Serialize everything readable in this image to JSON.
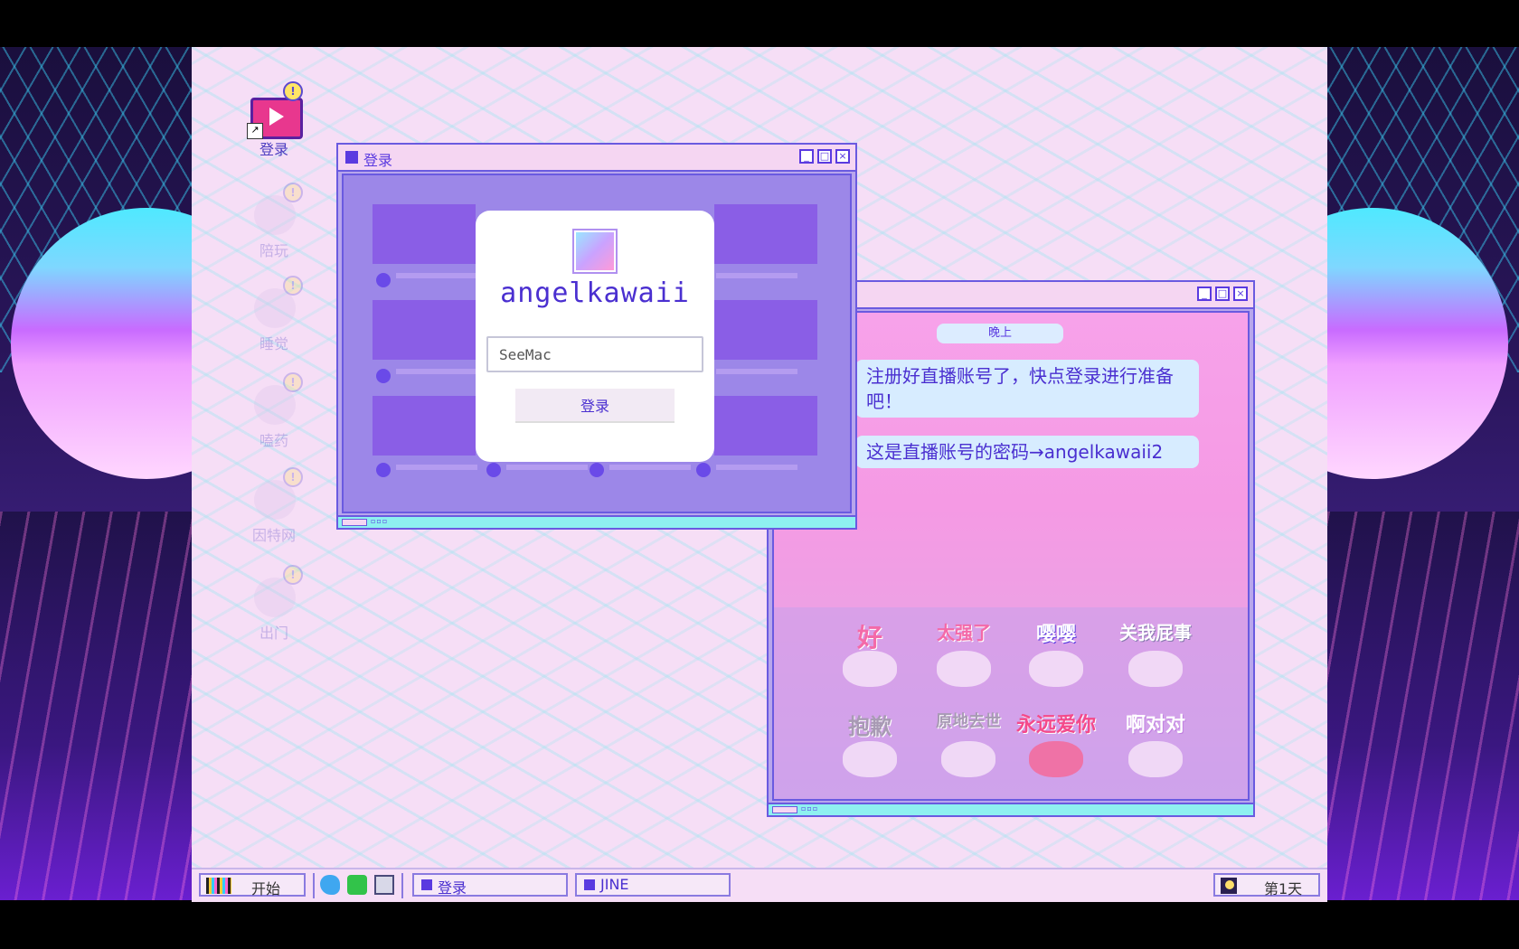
{
  "desktop": {
    "icons": [
      {
        "label": "登录",
        "badge": "!"
      },
      {
        "label": "陪玩",
        "badge": "!"
      },
      {
        "label": "睡觉",
        "badge": "!"
      },
      {
        "label": "嗑药",
        "badge": "!"
      },
      {
        "label": "因特网",
        "badge": "!"
      },
      {
        "label": "出门",
        "badge": "!"
      }
    ]
  },
  "login_window": {
    "title": "登录",
    "modal": {
      "username": "angelkawaii",
      "password_value": "SeeMac",
      "login_button": "登录"
    }
  },
  "chat_window": {
    "time_label": "晚上",
    "messages": [
      "注册好直播账号了，快点登录进行准备吧！",
      "这是直播账号的密码→angelkawaii2"
    ],
    "stickers": [
      "好",
      "太强了",
      "嘤嘤",
      "关我屁事",
      "抱歉",
      "原地去世",
      "永远爱你",
      "啊对对"
    ]
  },
  "taskbar": {
    "start_label": "开始",
    "tasks": [
      "登录",
      "JINE"
    ],
    "day_label": "第1天"
  },
  "window_controls": {
    "minimize": "_",
    "maximize": "□",
    "close": "×"
  },
  "colors": {
    "accent": "#5a3ae0",
    "desktop_bg": "#f6def6",
    "chat_bubble": "#d7ecff"
  }
}
